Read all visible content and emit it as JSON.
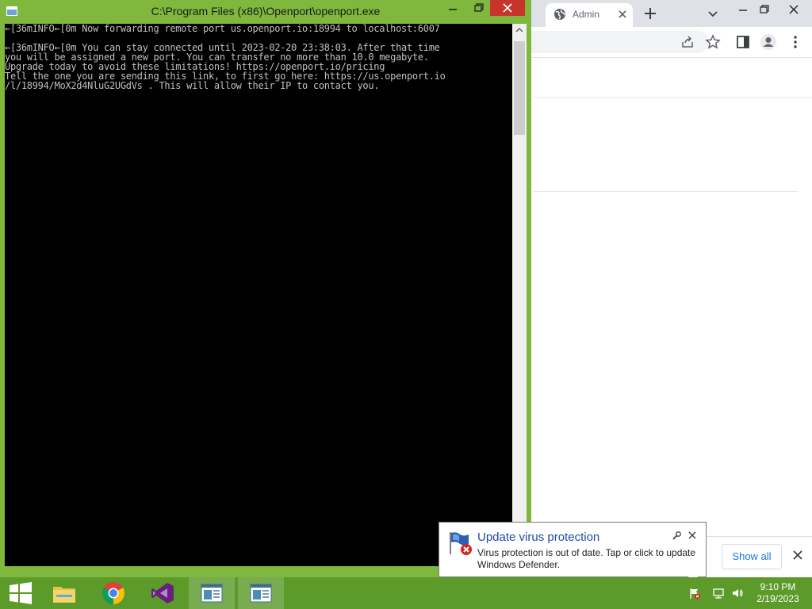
{
  "console": {
    "title": "C:\\Program Files (x86)\\Openport\\openport.exe",
    "lines": [
      "←[36mINFO←[0m Now forwarding remote port us.openport.io:18994 to localhost:6007",
      "",
      "←[36mINFO←[0m You can stay connected until 2023-02-20 23:38:03. After that time",
      "you will be assigned a new port. You can transfer no more than 10.0 megabyte.",
      "Upgrade today to avoid these limitations! https://openport.io/pricing",
      "Tell the one you are sending this link, to first go here: https://us.openport.io",
      "/l/18994/MoX2d4NluG2UGdVs . This will allow their IP to contact you."
    ]
  },
  "browser": {
    "tab_title": "Admin P",
    "download_bar": {
      "show_all_label": "Show all"
    }
  },
  "notification": {
    "title": "Update virus protection",
    "body": "Virus protection is out of date. Tap or click to update Windows Defender."
  },
  "taskbar": {
    "items": [
      "start",
      "file-explorer",
      "chrome",
      "visual-studio",
      "openport",
      "openport"
    ],
    "clock": {
      "time": "9:10 PM",
      "date": "2/19/2023"
    }
  },
  "colors": {
    "desktop": "#7fb83d",
    "taskbar": "#5c9a2a",
    "console_text": "#c0c0c0",
    "notification_title": "#1f4aa8",
    "chrome_accent": "#1a73e8"
  }
}
